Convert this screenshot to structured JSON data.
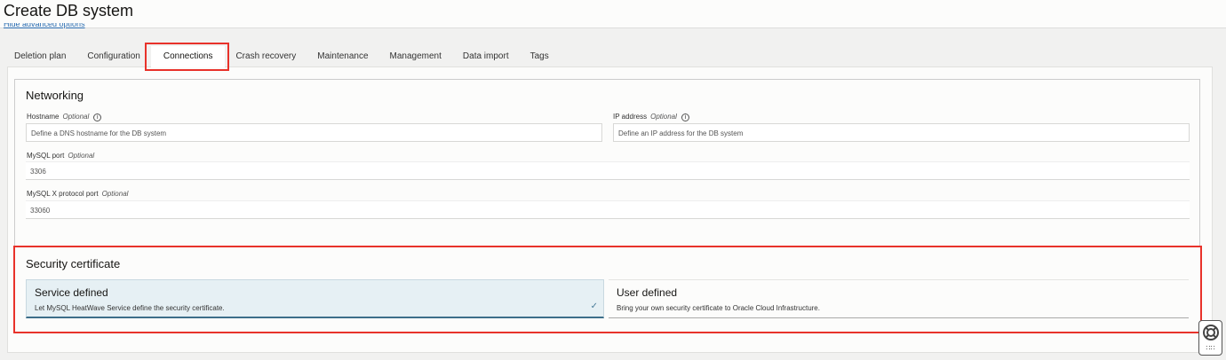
{
  "header": {
    "title": "Create DB system",
    "advanced_link": "Hide advanced options"
  },
  "tabs": [
    {
      "label": "Deletion plan"
    },
    {
      "label": "Configuration"
    },
    {
      "label": "Connections",
      "active": true
    },
    {
      "label": "Crash recovery"
    },
    {
      "label": "Maintenance"
    },
    {
      "label": "Management"
    },
    {
      "label": "Data import"
    },
    {
      "label": "Tags"
    }
  ],
  "networking": {
    "title": "Networking",
    "optional": "Optional",
    "hostname": {
      "label": "Hostname",
      "placeholder": "Define a DNS hostname for the DB system"
    },
    "ip": {
      "label": "IP address",
      "placeholder": "Define an IP address for the DB system"
    },
    "port": {
      "label": "MySQL port",
      "value": "3306"
    },
    "xport": {
      "label": "MySQL X protocol port",
      "value": "33060"
    }
  },
  "security": {
    "title": "Security certificate",
    "options": [
      {
        "title": "Service defined",
        "desc": "Let MySQL HeatWave Service define the security certificate.",
        "selected": true
      },
      {
        "title": "User defined",
        "desc": "Bring your own security certificate to Oracle Cloud Infrastructure.",
        "selected": false
      }
    ]
  },
  "colors": {
    "highlight": "#e8322a",
    "selected_card": "#e6f0f4",
    "link": "#2a6cb0"
  }
}
